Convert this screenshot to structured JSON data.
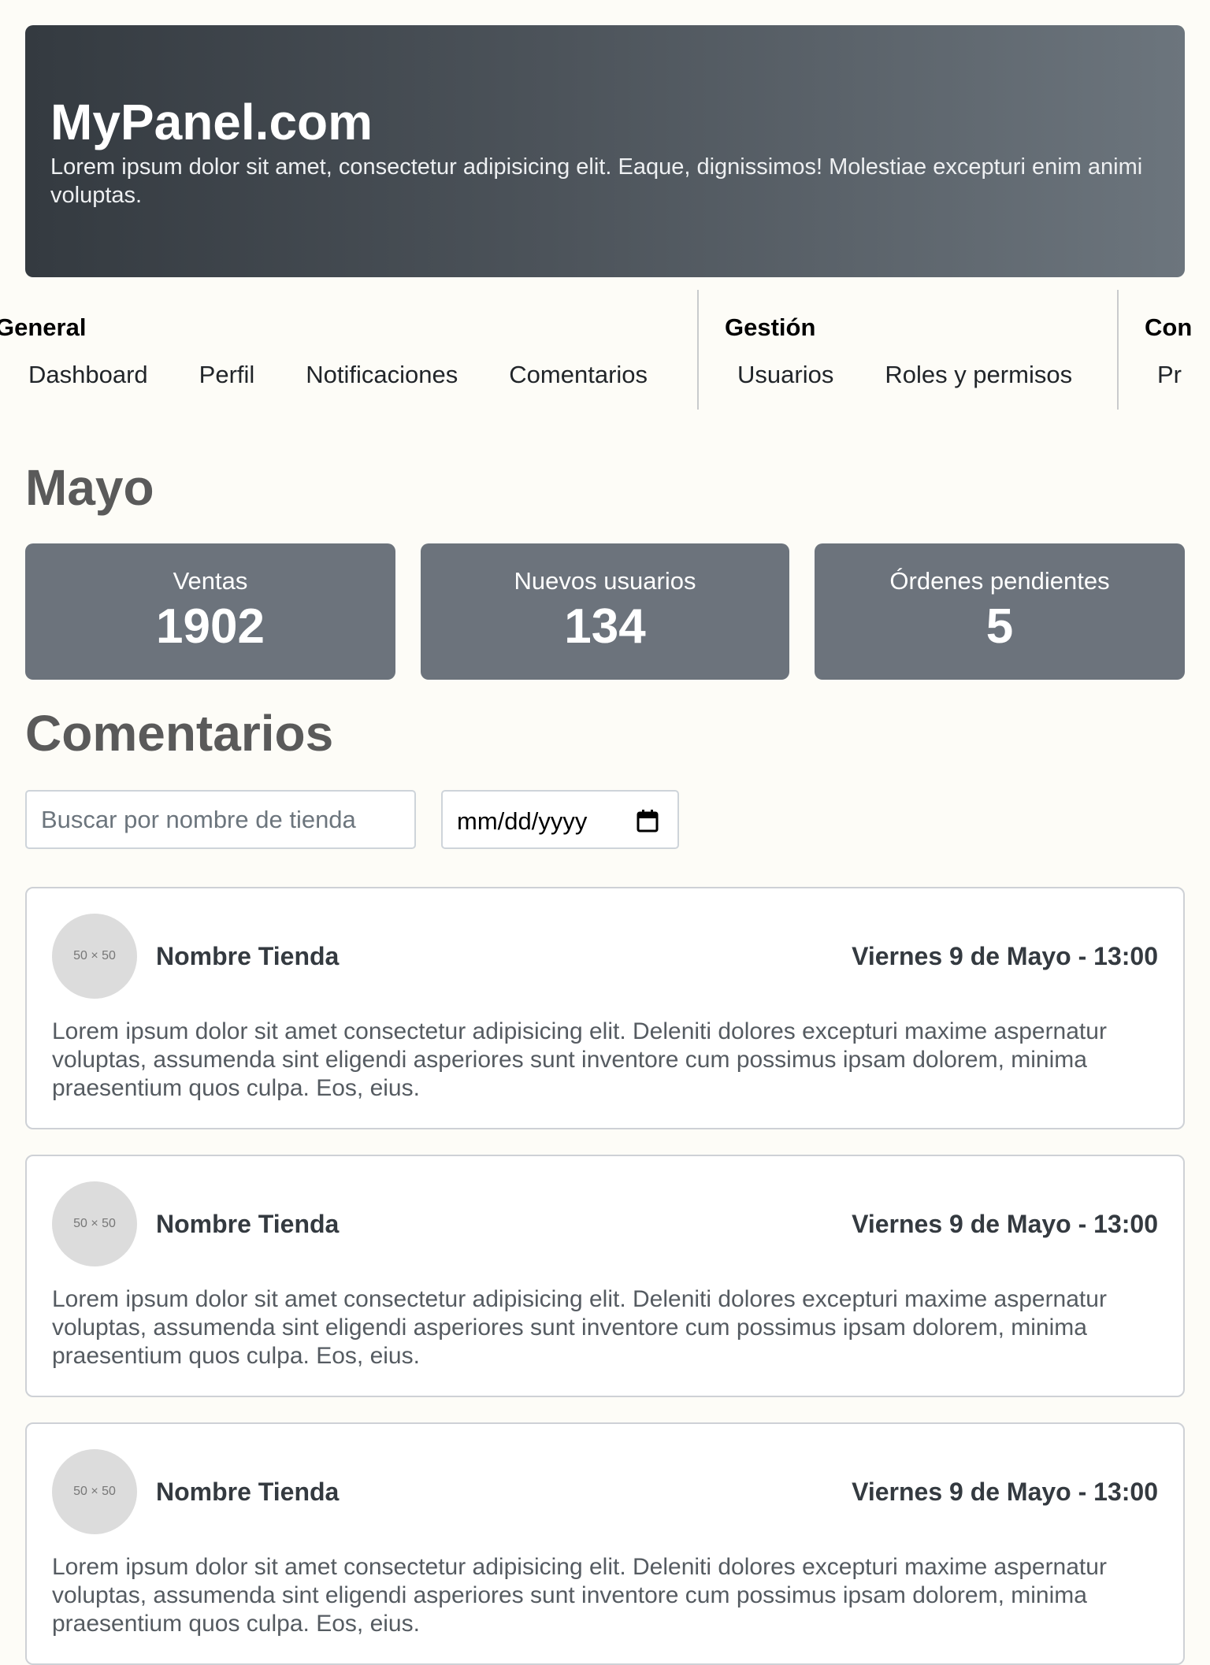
{
  "header": {
    "title": "MyPanel.com",
    "subtitle": "Lorem ipsum dolor sit amet, consectetur adipisicing elit. Eaque, dignissimos! Molestiae excepturi enim animi voluptas."
  },
  "nav": {
    "groups": [
      {
        "title": "General",
        "items": [
          "Dashboard",
          "Perfil",
          "Notificaciones",
          "Comentarios"
        ]
      },
      {
        "title": "Gestión",
        "items": [
          "Usuarios",
          "Roles y permisos"
        ]
      },
      {
        "title": "Con",
        "items": [
          "Pr"
        ]
      }
    ]
  },
  "stats": {
    "month": "Mayo",
    "cards": [
      {
        "label": "Ventas",
        "value": "1902"
      },
      {
        "label": "Nuevos usuarios",
        "value": "134"
      },
      {
        "label": "Órdenes pendientes",
        "value": "5"
      }
    ]
  },
  "comments": {
    "title": "Comentarios",
    "search_placeholder": "Buscar por nombre de tienda",
    "date_placeholder": "mm/dd/yyyy",
    "items": [
      {
        "avatar": "50 × 50",
        "store": "Nombre Tienda",
        "date": "Viernes 9 de Mayo - 13:00",
        "text": "Lorem ipsum dolor sit amet consectetur adipisicing elit. Deleniti dolores excepturi maxime aspernatur voluptas, assumenda sint eligendi asperiores sunt inventore cum possimus ipsam dolorem, minima praesentium quos culpa. Eos, eius."
      },
      {
        "avatar": "50 × 50",
        "store": "Nombre Tienda",
        "date": "Viernes 9 de Mayo - 13:00",
        "text": "Lorem ipsum dolor sit amet consectetur adipisicing elit. Deleniti dolores excepturi maxime aspernatur voluptas, assumenda sint eligendi asperiores sunt inventore cum possimus ipsam dolorem, minima praesentium quos culpa. Eos, eius."
      },
      {
        "avatar": "50 × 50",
        "store": "Nombre Tienda",
        "date": "Viernes 9 de Mayo - 13:00",
        "text": "Lorem ipsum dolor sit amet consectetur adipisicing elit. Deleniti dolores excepturi maxime aspernatur voluptas, assumenda sint eligendi asperiores sunt inventore cum possimus ipsam dolorem, minima praesentium quos culpa. Eos, eius."
      }
    ]
  }
}
